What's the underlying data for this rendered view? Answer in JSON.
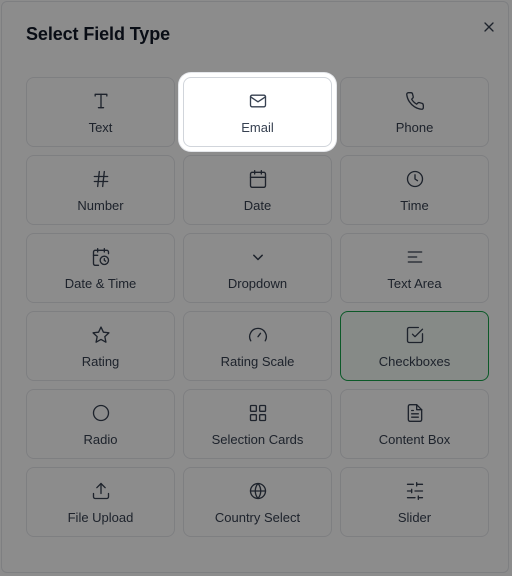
{
  "modal": {
    "title": "Select Field Type",
    "close_icon": "close-icon"
  },
  "colors": {
    "selected_border": "#16a34a",
    "overlay": "rgba(0,0,0,0.45)"
  },
  "field_types": [
    {
      "label": "Text",
      "icon": "text-icon"
    },
    {
      "label": "Email",
      "icon": "mail-icon",
      "state": "highlighted"
    },
    {
      "label": "Phone",
      "icon": "phone-icon"
    },
    {
      "label": "Number",
      "icon": "hash-icon"
    },
    {
      "label": "Date",
      "icon": "calendar-icon"
    },
    {
      "label": "Time",
      "icon": "clock-icon"
    },
    {
      "label": "Date & Time",
      "icon": "calendar-clock-icon"
    },
    {
      "label": "Dropdown",
      "icon": "chevron-down-icon"
    },
    {
      "label": "Text Area",
      "icon": "text-align-icon"
    },
    {
      "label": "Rating",
      "icon": "star-icon"
    },
    {
      "label": "Rating Scale",
      "icon": "gauge-icon"
    },
    {
      "label": "Checkboxes",
      "icon": "checkbox-icon",
      "state": "selected"
    },
    {
      "label": "Radio",
      "icon": "circle-icon"
    },
    {
      "label": "Selection Cards",
      "icon": "grid-icon"
    },
    {
      "label": "Content Box",
      "icon": "document-icon"
    },
    {
      "label": "File Upload",
      "icon": "upload-icon"
    },
    {
      "label": "Country Select",
      "icon": "globe-icon"
    },
    {
      "label": "Slider",
      "icon": "sliders-icon"
    }
  ]
}
